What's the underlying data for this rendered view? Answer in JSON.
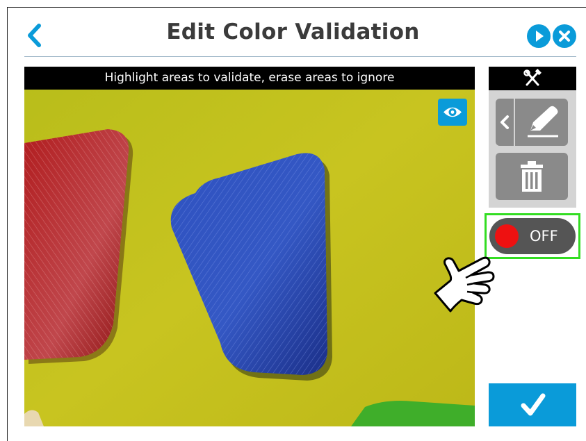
{
  "header": {
    "title": "Edit Color Validation",
    "back_icon": "chevron-left-icon",
    "play_icon": "play-icon",
    "close_icon": "close-icon",
    "accent_color": "#0a9bd9"
  },
  "camera": {
    "instruction": "Highlight areas to validate, erase areas to ignore",
    "eye_icon": "eye-icon",
    "background_color": "#c4c21a"
  },
  "tools": {
    "header_icon": "tools-icon",
    "collapse_icon": "chevron-left-icon",
    "draw_icon": "pen-icon",
    "delete_icon": "trash-icon"
  },
  "toggle": {
    "label": "OFF",
    "state": "off",
    "indicator_color": "#ee1111",
    "highlight_color": "#33dd22"
  },
  "pointer": {
    "icon": "hand-pointer-icon"
  },
  "confirm": {
    "icon": "checkmark-icon"
  }
}
